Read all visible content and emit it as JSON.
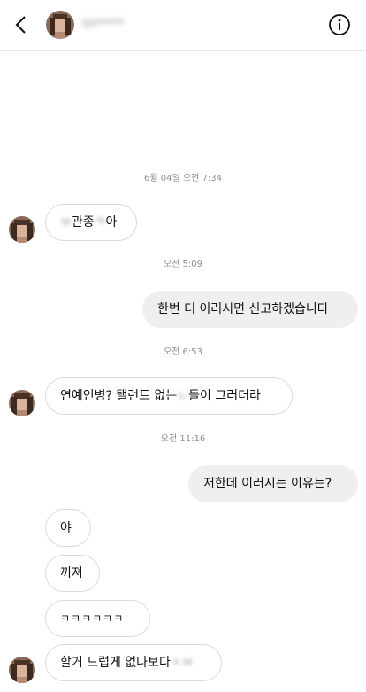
{
  "header": {
    "back_icon": "chevron-left-icon",
    "contact_name": "tri*****",
    "info_icon": "info-circle-icon"
  },
  "colors": {
    "incoming_border": "#dbdbdb",
    "outgoing_bg": "#efefef",
    "timestamp": "#8e8e8e"
  },
  "thread": {
    "timestamps": [
      "6월 04일 오전 7:34",
      "오전 5:09",
      "오전 6:53",
      "오전 11:16"
    ],
    "messages": [
      {
        "pre": "",
        "blur1": "ㅂ",
        "mid": "관종",
        "blur2": "ㅋ",
        "post": "아"
      },
      {
        "text": "한번 더 이러시면 신고하겠습니다"
      },
      {
        "pre": "연예인병? 탤런트 없는",
        "blur": "ㄴ",
        "post": "들이 그러더라"
      },
      {
        "text": "저한데 이러시는 이유는?"
      },
      {
        "text": "야"
      },
      {
        "text": "꺼져"
      },
      {
        "text": "ㅋㅋㅋㅋㅋㅋ"
      },
      {
        "pre": "할거 드럽게 없나보다 ",
        "blur": "ㅅㅂ"
      }
    ]
  }
}
